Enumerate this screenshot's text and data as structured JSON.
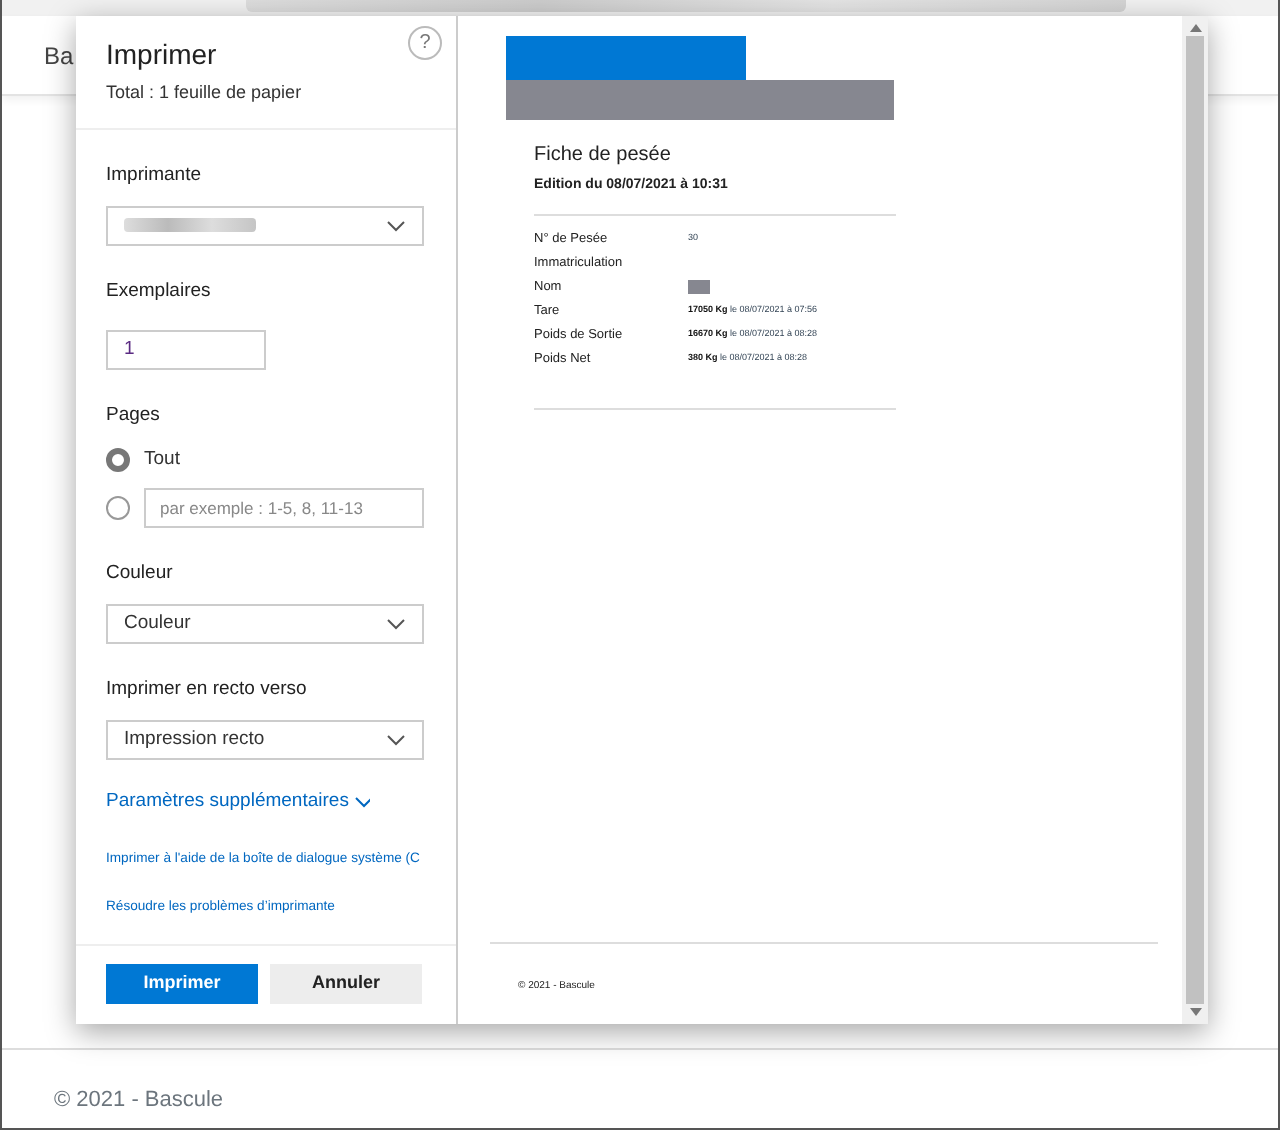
{
  "page": {
    "brand": "Ba",
    "footer": "© 2021 - Bascule"
  },
  "dialog": {
    "title": "Imprimer",
    "subtitle": "Total : 1 feuille de papier",
    "help": "?",
    "printer": {
      "label": "Imprimante"
    },
    "copies": {
      "label": "Exemplaires",
      "value": "1"
    },
    "pages": {
      "label": "Pages",
      "options": [
        {
          "kind": "label",
          "text": "Tout",
          "selected": true
        },
        {
          "kind": "field",
          "placeholder": "par exemple : 1-5, 8, 11-13",
          "selected": false
        }
      ]
    },
    "color": {
      "label": "Couleur",
      "value": "Couleur"
    },
    "duplex": {
      "label": "Imprimer en recto verso",
      "value": "Impression recto"
    },
    "more_settings": "Paramètres supplémentaires",
    "links": [
      "Imprimer à l'aide de la boîte de dialogue système (C",
      "Résoudre les problèmes d’imprimante"
    ],
    "buttons": [
      {
        "label": "Imprimer",
        "kind": "primary"
      },
      {
        "label": "Annuler",
        "kind": "secondary"
      }
    ]
  },
  "preview": {
    "title": "Fiche de pesée",
    "subtitle": "Edition du 08/07/2021 à 10:31",
    "fields": [
      {
        "label": "N° de Pesée",
        "kind": "text",
        "value": "30"
      },
      {
        "label": "Immatriculation",
        "kind": "empty"
      },
      {
        "label": "Nom",
        "kind": "redacted"
      },
      {
        "label": "Tare",
        "kind": "text",
        "value": "**17050 Kg** le 08/07/2021 à 07:56"
      },
      {
        "label": "Poids de Sortie",
        "kind": "text",
        "value": "**16670 Kg** le 08/07/2021 à 08:28"
      },
      {
        "label": "Poids Net",
        "kind": "text",
        "value": "**380 Kg** le 08/07/2021 à 08:28"
      }
    ],
    "footer": "© 2021 - Bascule"
  }
}
